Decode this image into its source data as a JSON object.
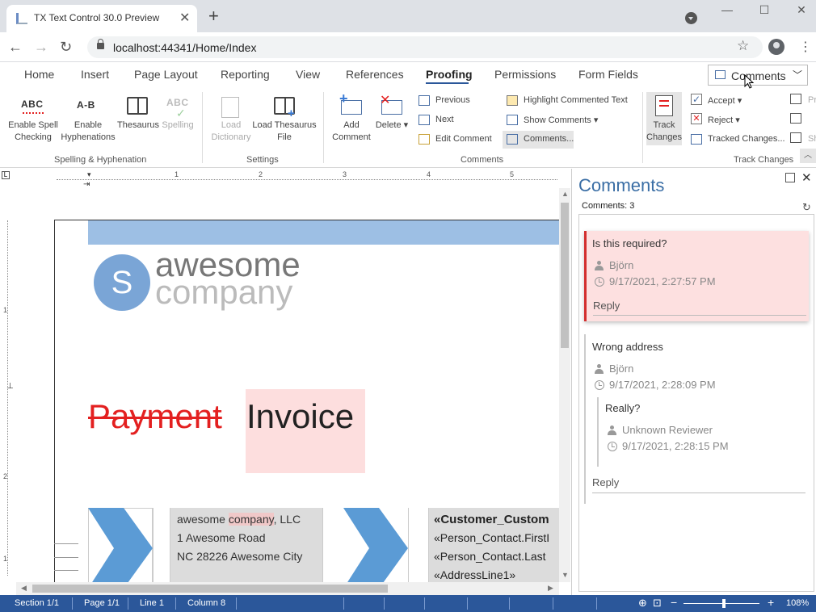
{
  "browser": {
    "tab_title": "TX Text Control 30.0 Preview",
    "url": "localhost:44341/Home/Index"
  },
  "ribbon": {
    "tabs": [
      "Home",
      "Insert",
      "Page Layout",
      "Reporting",
      "View",
      "References",
      "Proofing",
      "Permissions",
      "Form Fields"
    ],
    "active_tab": "Proofing",
    "comments_dropdown": "Comments",
    "spelling": {
      "enable_spell_1": "Enable Spell",
      "enable_spell_2": "Checking",
      "enable_hyph_1": "Enable",
      "enable_hyph_2": "Hyphenations",
      "thesaurus": "Thesaurus",
      "spelling": "Spelling",
      "group": "Spelling & Hyphenation"
    },
    "settings": {
      "load_dict_1": "Load",
      "load_dict_2": "Dictionary",
      "load_thes_1": "Load Thesaurus",
      "load_thes_2": "File",
      "group": "Settings"
    },
    "comments": {
      "add_1": "Add",
      "add_2": "Comment",
      "delete": "Delete",
      "previous": "Previous",
      "next": "Next",
      "edit": "Edit Comment",
      "highlight": "Highlight Commented Text",
      "show": "Show Comments",
      "comments_dlg": "Comments...",
      "group": "Comments"
    },
    "track": {
      "track_1": "Track",
      "track_2": "Changes",
      "accept": "Accept",
      "reject": "Reject",
      "tracked": "Tracked Changes...",
      "group": "Track Changes",
      "cut_1": "Pr",
      "cut_3": "Sh"
    }
  },
  "ruler": {
    "h_numbers": [
      "1",
      "2",
      "3",
      "4",
      "5"
    ],
    "v_numbers": [
      "1",
      "1",
      "2",
      "1"
    ]
  },
  "document": {
    "logo_letter": "S",
    "logo_word1": "awesome",
    "logo_word2": "company",
    "deleted_word": "Payment",
    "inserted_word": "Invoice",
    "address": {
      "line1_a": "awesome ",
      "line1_hl": "company",
      "line1_b": ", LLC",
      "line2": "1 Awesome Road",
      "line3": "NC 28226 Awesome City"
    },
    "merge": {
      "line1": "«Customer_Custom",
      "line2": "«Person_Contact.FirstI",
      "line3": "«Person_Contact.Last",
      "line4": "«AddressLine1»"
    }
  },
  "comments_panel": {
    "title": "Comments",
    "count": "Comments: 3",
    "items": [
      {
        "text": "Is this required?",
        "author": "Björn",
        "time": "9/17/2021, 2:27:57 PM",
        "reply": "Reply"
      },
      {
        "text": "Wrong address",
        "author": "Björn",
        "time": "9/17/2021, 2:28:09 PM",
        "nested": {
          "text": "Really?",
          "author": "Unknown Reviewer",
          "time": "9/17/2021, 2:28:15 PM"
        },
        "reply": "Reply"
      }
    ]
  },
  "statusbar": {
    "section": "Section 1/1",
    "page": "Page 1/1",
    "line": "Line 1",
    "column": "Column 8",
    "zoom": "108%"
  },
  "colors": {
    "accent": "#2b579a",
    "comment_active": "#fde0e0",
    "comment_border": "#d32f2f",
    "deleted": "#e32020"
  }
}
